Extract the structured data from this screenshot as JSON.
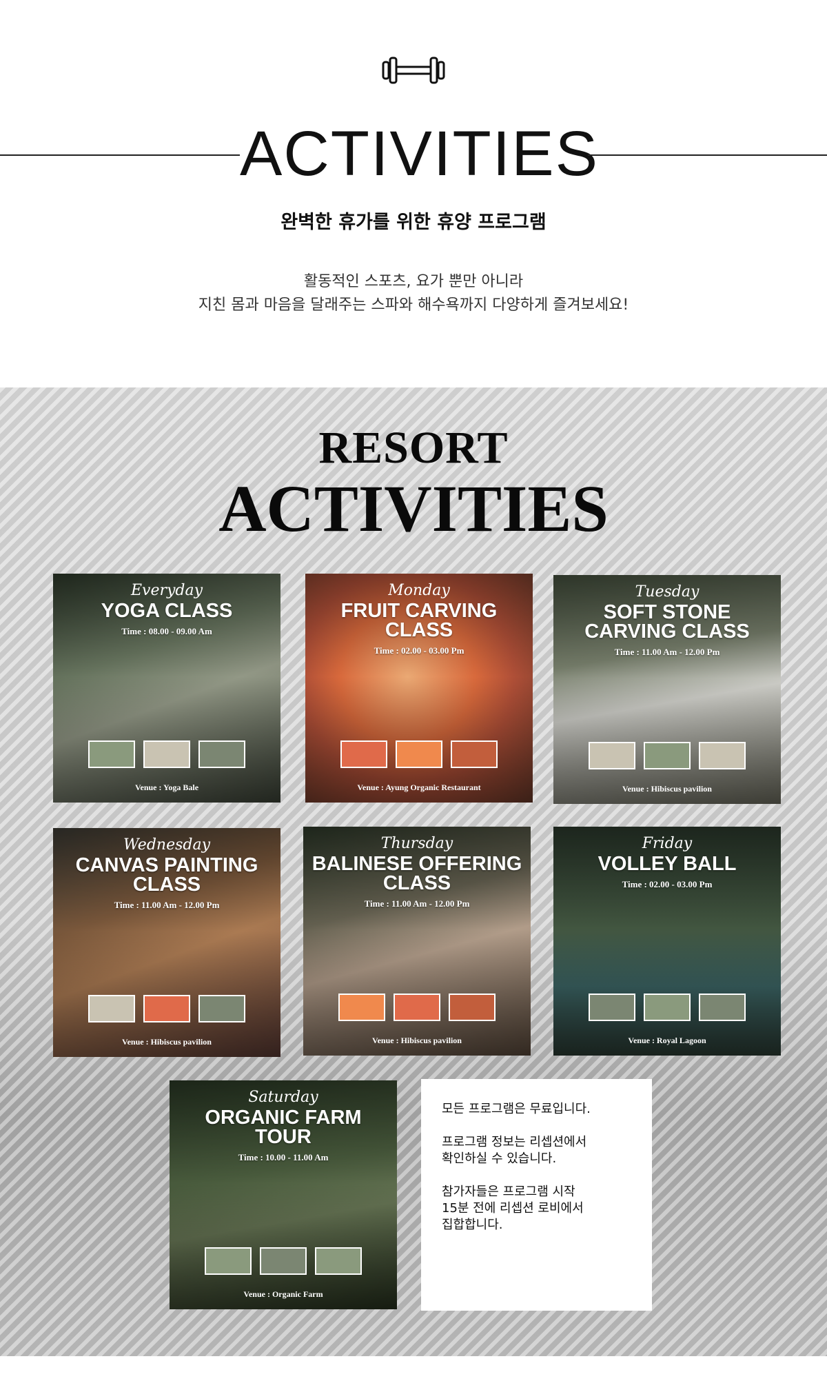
{
  "header": {
    "icon": "dumbbell-icon",
    "title": "ACTIVITIES",
    "subtitle": "완벽한 휴가를 위한 휴양 프로그램",
    "desc_line1": "활동적인 스포츠, 요가 뿐만 아니라",
    "desc_line2": "지친 몸과 마음을 달래주는 스파와 해수욕까지 다양하게 즐겨보세요!"
  },
  "resort": {
    "title_top": "RESORT",
    "title_bottom": "ACTIVITIES"
  },
  "cards": [
    {
      "day": "Everyday",
      "title": "YOGA CLASS",
      "time": "Time : 08.00 - 09.00 Am",
      "venue": "Venue : Yoga Bale"
    },
    {
      "day": "Monday",
      "title": "FRUIT CARVING CLASS",
      "time": "Time : 02.00 - 03.00 Pm",
      "venue": "Venue : Ayung Organic Restaurant"
    },
    {
      "day": "Tuesday",
      "title": "SOFT STONE CARVING CLASS",
      "time": "Time : 11.00 Am - 12.00 Pm",
      "venue": "Venue : Hibiscus pavilion"
    },
    {
      "day": "Wednesday",
      "title": "CANVAS PAINTING CLASS",
      "time": "Time : 11.00 Am - 12.00 Pm",
      "venue": "Venue : Hibiscus pavilion"
    },
    {
      "day": "Thursday",
      "title": "BALINESE OFFERING CLASS",
      "time": "Time : 11.00 Am - 12.00 Pm",
      "venue": "Venue : Hibiscus pavilion"
    },
    {
      "day": "Friday",
      "title": "VOLLEY BALL",
      "time": "Time : 02.00 - 03.00 Pm",
      "venue": "Venue : Royal Lagoon"
    },
    {
      "day": "Saturday",
      "title": "ORGANIC FARM TOUR",
      "time": "Time : 10.00 - 11.00 Am",
      "venue": "Venue : Organic Farm"
    }
  ],
  "info": {
    "line1": "모든 프로그램은 무료입니다.",
    "line2a": "프로그램 정보는 리셉션에서",
    "line2b": "확인하실 수 있습니다.",
    "line3a": "참가자들은 프로그램 시작",
    "line3b": "15분 전에 리셉션 로비에서",
    "line3c": "집합합니다."
  }
}
